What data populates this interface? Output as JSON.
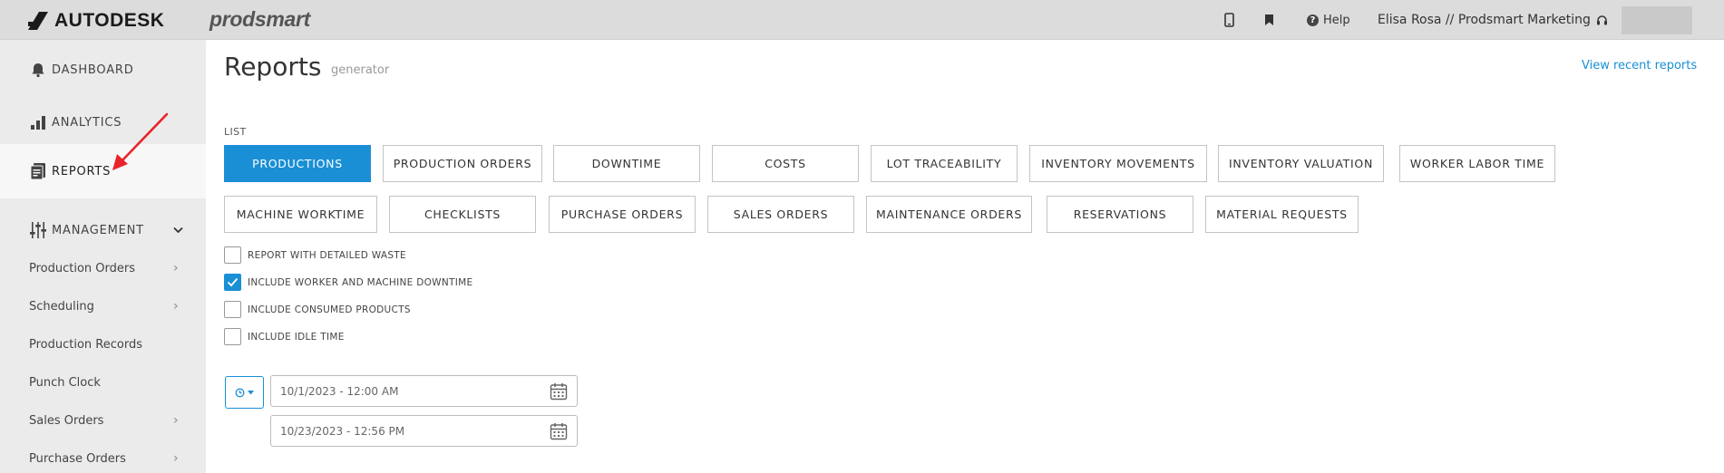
{
  "header": {
    "brand": "AUTODESK",
    "product": "prodsmart",
    "help_label": "Help",
    "help_glyph": "?",
    "user_label": "Elisa Rosa // Prodsmart Marketing"
  },
  "sidebar": {
    "items": [
      {
        "label": "DASHBOARD",
        "icon": "bell-icon"
      },
      {
        "label": "ANALYTICS",
        "icon": "bar-chart-icon"
      },
      {
        "label": "REPORTS",
        "icon": "report-icon",
        "active": true
      },
      {
        "label": "MANAGEMENT",
        "icon": "sliders-icon",
        "expanded": true
      }
    ],
    "sub_items": [
      {
        "label": "Production Orders",
        "has_chevron": true
      },
      {
        "label": "Scheduling",
        "has_chevron": true
      },
      {
        "label": "Production Records",
        "has_chevron": false
      },
      {
        "label": "Punch Clock",
        "has_chevron": false
      },
      {
        "label": "Sales Orders",
        "has_chevron": true
      },
      {
        "label": "Purchase Orders",
        "has_chevron": true
      }
    ]
  },
  "main": {
    "title": "Reports",
    "subtitle": "generator",
    "view_recent": "View recent reports",
    "list_label": "LIST",
    "report_buttons_row1": [
      "PRODUCTIONS",
      "PRODUCTION ORDERS",
      "DOWNTIME",
      "COSTS",
      "LOT TRACEABILITY",
      "INVENTORY MOVEMENTS",
      "INVENTORY VALUATION",
      "WORKER LABOR TIME"
    ],
    "report_buttons_row2": [
      "MACHINE WORKTIME",
      "CHECKLISTS",
      "PURCHASE ORDERS",
      "SALES ORDERS",
      "MAINTENANCE ORDERS",
      "RESERVATIONS",
      "MATERIAL REQUESTS"
    ],
    "active_report": "PRODUCTIONS",
    "options": [
      {
        "label": "REPORT WITH DETAILED WASTE",
        "checked": false
      },
      {
        "label": "INCLUDE WORKER AND MACHINE DOWNTIME",
        "checked": true
      },
      {
        "label": "INCLUDE CONSUMED PRODUCTS",
        "checked": false
      },
      {
        "label": "INCLUDE IDLE TIME",
        "checked": false
      }
    ],
    "date_from": "10/1/2023 - 12:00 AM",
    "date_to": "10/23/2023 - 12:56 PM"
  },
  "colors": {
    "accent": "#1a8fd6",
    "topbar": "#dcdcdc",
    "sidebar": "#ebebeb",
    "annotation_arrow": "#e8232a"
  }
}
